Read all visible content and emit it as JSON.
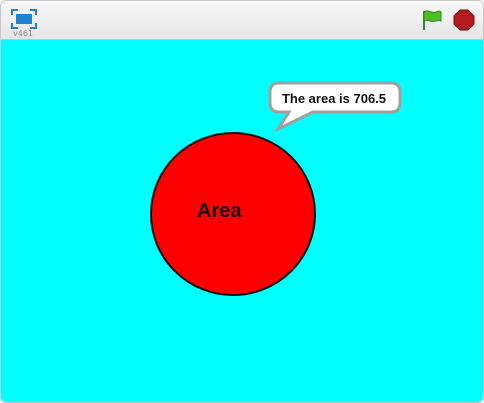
{
  "toolbar": {
    "version_label": "v461",
    "fullscreen_icon": "fullscreen-icon",
    "green_flag_icon": "green-flag-icon",
    "stop_icon": "stop-icon"
  },
  "stage": {
    "background_color": "#00ffff",
    "sprite": {
      "label": "Area",
      "fill_color": "#ff0000",
      "shape": "circle"
    },
    "speech_bubble": {
      "text": "The area is 706.5"
    }
  }
}
